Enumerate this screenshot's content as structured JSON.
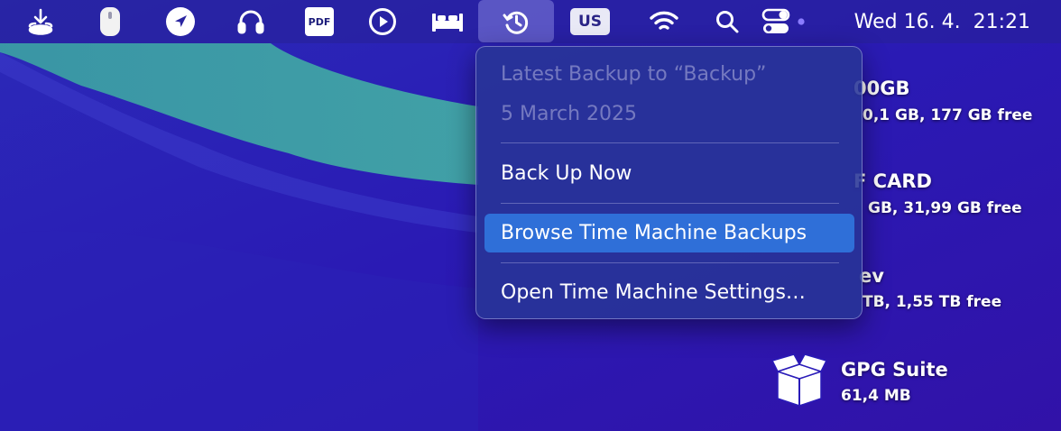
{
  "menubar": {
    "icons": [
      "download-icon",
      "mouse-icon",
      "location-arrow-icon",
      "headphones-icon",
      "pdf-icon",
      "play-icon",
      "bed-icon",
      "time-machine-icon",
      "input-source-icon",
      "wifi-icon",
      "spotlight-search-icon",
      "control-center-icon"
    ],
    "pdf_label": "PDF",
    "input_source_label": "US",
    "clock": "Wed 16. 4.  21:21"
  },
  "menu": {
    "header_line1": "Latest Backup to “Backup”",
    "header_line2": "5 March 2025",
    "back_up_now": "Back Up Now",
    "browse_backups": "Browse Time Machine Backups",
    "open_settings": "Open Time Machine Settings…"
  },
  "desktop": {
    "drive1": {
      "name": "00GB",
      "info": "0,1 GB, 177 GB free"
    },
    "drive2": {
      "name": "F CARD",
      "info": "GB, 31,99 GB free"
    },
    "drive3": {
      "name": "ev",
      "info": "TB, 1,55 TB free"
    },
    "app": {
      "name": "GPG Suite",
      "info": "61,4 MB"
    }
  },
  "colors": {
    "wallpaper_base": "#2a1bb8",
    "wallpaper_teal": "#3aa0a4",
    "menu_highlight": "#2f6fd8",
    "menubar_active": "#7d7dd6"
  }
}
